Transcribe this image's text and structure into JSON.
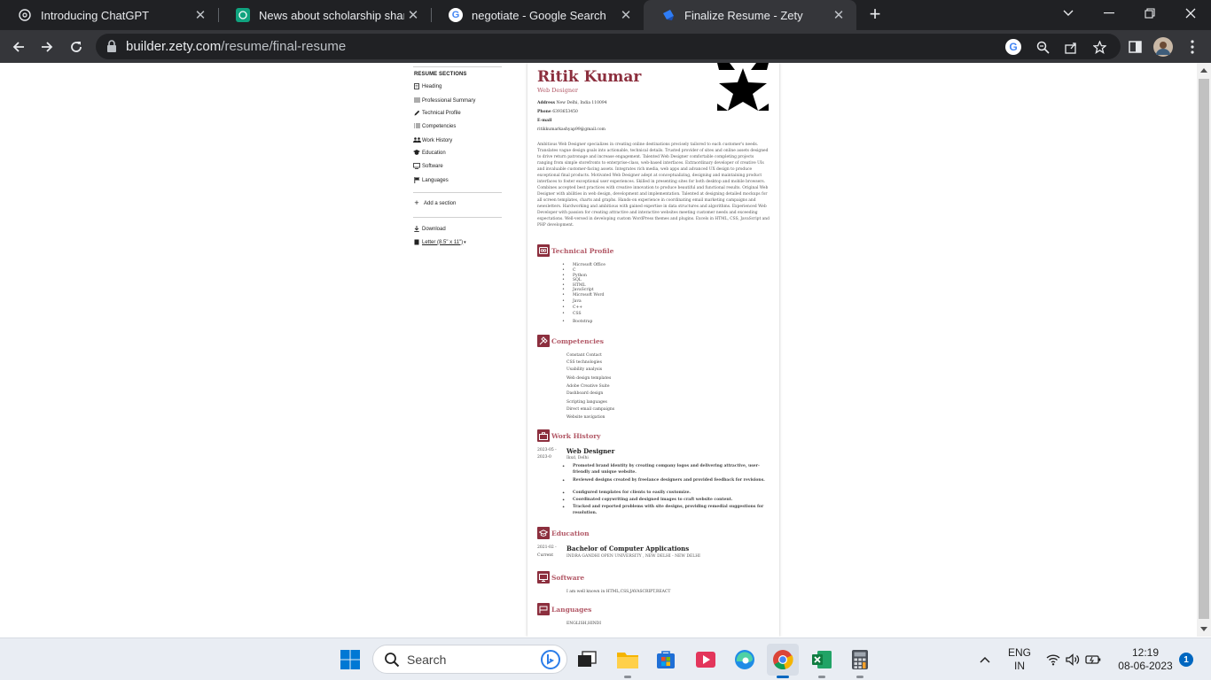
{
  "browser": {
    "tabs": [
      {
        "title": "Introducing ChatGPT",
        "icon": "chatgpt-icon",
        "active": false
      },
      {
        "title": "News about scholarship shared.",
        "icon": "chatgpt-icon",
        "active": false
      },
      {
        "title": "negotiate - Google Search",
        "icon": "google-icon",
        "active": false
      },
      {
        "title": "Finalize Resume - Zety",
        "icon": "zety-icon",
        "active": true
      }
    ],
    "url_host": "builder.zety.com",
    "url_path": "/resume/final-resume"
  },
  "sidebar": {
    "header": "RESUME SECTIONS",
    "items": [
      {
        "label": "Heading",
        "icon": "document-icon"
      },
      {
        "label": "Professional Summary",
        "icon": "lines-icon"
      },
      {
        "label": "Technical Profile",
        "icon": "pencil-icon"
      },
      {
        "label": "Competencies",
        "icon": "list-icon"
      },
      {
        "label": "Work History",
        "icon": "people-icon"
      },
      {
        "label": "Education",
        "icon": "graduation-cap-icon"
      },
      {
        "label": "Software",
        "icon": "monitor-icon"
      },
      {
        "label": "Languages",
        "icon": "flag-icon"
      }
    ],
    "add_section": "Add a section",
    "download": "Download",
    "paper_size": "Letter (8.5\" x 11\")"
  },
  "resume": {
    "name": "Ritik Kumar",
    "title": "Web Designer",
    "address_label": "Address",
    "address": "New Delhi, India 110094",
    "phone_label": "Phone",
    "phone": "6393653450",
    "email_label": "E-mail",
    "email": "ritikkumarkashyap99@gmail.com",
    "summary": "Ambitious Web Designer specializes in creating online destinations precisely tailored to each customer's needs. Translates vague design goals into actionable, technical details. Trusted provider of sites and online assets designed to drive return patronage and increase engagement. Talented Web Designer comfortable completing projects ranging from simple storefronts to enterprise-class, web-based interfaces. Extraordinary developer of creative UIs and invaluable customer-facing assets. Integrates rich media, web apps and advanced UX design to produce exceptional final products. Motivated Web Designer adept at conceptualizing, designing and maintaining product interfaces to foster exceptional user experiences. Skilled in presenting sites for both desktop and mobile browsers. Combines accepted best practices with creative innovation to produce beautiful and functional results. Original Web Designer with abilities in web design, development and implementation. Talented at designing detailed mockups for all screen templates, charts and graphs. Hands-on experience in coordinating email marketing campaigns and newsletters. Hardworking and ambitious with gained expertise in data structures and algorithms. Experienced Web Developer with passion for creating attractive and interactive websites meeting customer needs and exceeding expectations. Well-versed in developing custom WordPress themes and plugins. Excels in HTML, CSS, JavaScript and PHP development.",
    "technical_profile": {
      "title": "Technical Profile",
      "items": [
        "Microsoft Office",
        "C",
        "Python",
        "SQL",
        "HTML",
        "JavaScript",
        "Microsoft Word",
        "Java",
        "C++",
        "CSS",
        "Bootstrap"
      ]
    },
    "competencies": {
      "title": "Competencies",
      "items": [
        "Constant Contact",
        "CSS technologies",
        "Usability analysis",
        "Web design templates",
        "Adobe Creative Suite",
        "Dashboard design",
        "Scripting languages",
        "Direct email campaigns",
        "Website navigation"
      ]
    },
    "work_history": {
      "title": "Work History",
      "date_start": "2023-05 -",
      "date_end": "2023-0",
      "job_title": "Web Designer",
      "location": "Ikxd, Delhi",
      "bullets": [
        "Promoted brand identity by creating company logos and delivering attractive, user-friendly and unique website.",
        "Reviewed designs created by freelance designers and provided feedback for revisions.",
        "Configured templates for clients to easily customize.",
        "Coordinated copywriting and designed images to craft website content.",
        "Tracked and reported problems with site designs, providing remedial suggestions for resolution."
      ]
    },
    "education": {
      "title": "Education",
      "date_start": "2021-02 -",
      "date_end": "Current",
      "degree": "Bachelor of Computer Applications",
      "school": "INDRA GANDHI OPEN UNIVERSITY , NEW DELHI - NEW DELHI"
    },
    "software": {
      "title": "Software",
      "text": "I am well known in HTML,CSS,JAVASCRIPT,REACT"
    },
    "languages": {
      "title": "Languages",
      "text": "ENGLISH,HINDI"
    }
  },
  "taskbar": {
    "search_placeholder": "Search",
    "lang_line1": "ENG",
    "lang_line2": "IN",
    "time": "12:19",
    "date": "08-06-2023",
    "notification_count": "1"
  },
  "colors": {
    "accent": "#8c2f3e",
    "accent_light": "#b25866",
    "chrome_dark": "#202124",
    "chrome_toolbar": "#35363a"
  }
}
